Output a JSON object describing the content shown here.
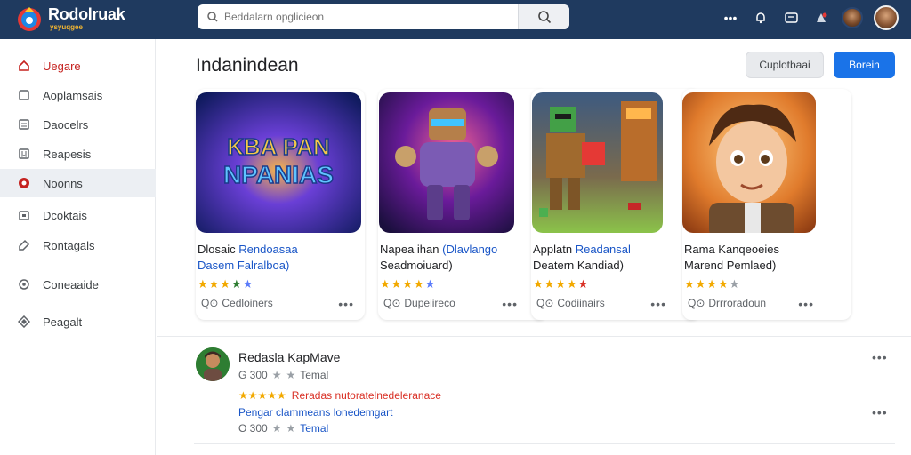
{
  "header": {
    "brand": "Rodolruak",
    "brand_sub": "ysyuqgee",
    "search_placeholder": "Beddalarn opglicieon",
    "colors": {
      "bar": "#1f3a5f",
      "accent": "#1a73e8"
    }
  },
  "sidebar": {
    "items": [
      {
        "label": "Uegare",
        "icon": "home-icon",
        "active": true
      },
      {
        "label": "Aoplamsais",
        "icon": "apps-icon"
      },
      {
        "label": "Daocelrs",
        "icon": "list-icon"
      },
      {
        "label": "Reapesis",
        "icon": "bookmark-icon"
      },
      {
        "label": "Noonns",
        "icon": "shield-icon",
        "selected": true
      },
      {
        "label": "Dcoktais",
        "icon": "calendar-icon"
      },
      {
        "label": "Rontagals",
        "icon": "tag-icon"
      },
      {
        "label": "Coneaaide",
        "icon": "circle-icon"
      },
      {
        "label": "Peagalt",
        "icon": "diamond-icon"
      }
    ]
  },
  "main": {
    "title": "Indanindean",
    "btn_secondary": "Cuplotbaai",
    "btn_primary": "Borein"
  },
  "cards": [
    {
      "art_text": [
        "KBA PAN",
        "NPANIAS"
      ],
      "title_a": "Dlosaic ",
      "title_b": "Rendoasaa",
      "sub_a": "Dasem ",
      "sub_b": "Falralboa)",
      "meta": "Cedloiners",
      "stars": [
        "gold",
        "gold",
        "gold",
        "blue",
        "blue"
      ]
    },
    {
      "title_a": "Napea ihan ",
      "title_b": "(Dlavlango",
      "sub_a": "Seadmoiuard)",
      "sub_b": "",
      "meta": "Dupeiireco",
      "stars": [
        "gold",
        "gold",
        "gold",
        "gold",
        "blue"
      ]
    },
    {
      "title_a": "Applatn ",
      "title_b": "Readansal",
      "sub_a": "Deatern Kandiad)",
      "sub_b": "",
      "meta": "Codiinairs",
      "stars": [
        "gold",
        "gold",
        "gold",
        "gold",
        "red"
      ]
    },
    {
      "title_a": "Rama Kanqeoeies",
      "title_b": "",
      "sub_a": "Marend Pemlaed)",
      "sub_b": "",
      "meta": "Drrroradoun",
      "stars": [
        "gold",
        "gold",
        "gold",
        "gold",
        "grey"
      ]
    }
  ],
  "review": {
    "name": "Redasla KapMave",
    "meta_a": "G 300",
    "meta_b": "Temal",
    "line1": "Reradas nutoratelnedeleranace",
    "line2": "Pengar clammeans lonedemgart",
    "meta2_a": "O 300",
    "meta2_b": "Temal"
  }
}
